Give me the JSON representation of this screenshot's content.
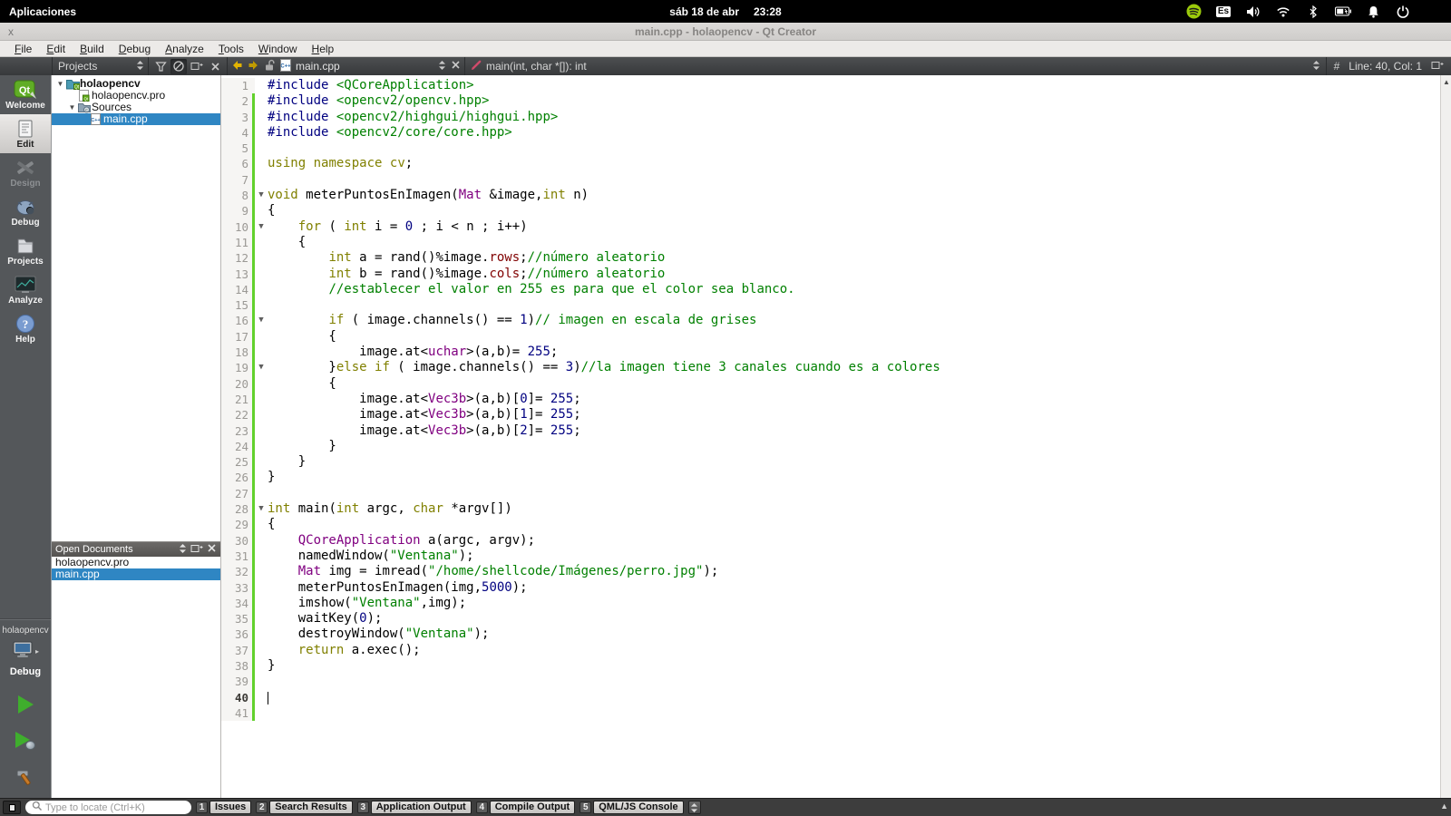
{
  "desktop": {
    "apps_menu": "Aplicaciones",
    "clock_date": "sáb 18 de abr",
    "clock_time": "23:28",
    "tray": [
      {
        "icon": "spotify-icon"
      },
      {
        "icon": "keyboard-layout-icon",
        "label": "Es"
      },
      {
        "icon": "volume-icon"
      },
      {
        "icon": "wifi-icon"
      },
      {
        "icon": "bluetooth-icon"
      },
      {
        "icon": "battery-icon"
      },
      {
        "icon": "notifications-bell-icon"
      },
      {
        "icon": "power-icon"
      }
    ]
  },
  "window": {
    "close_label": "x",
    "title": "main.cpp - holaopencv - Qt Creator",
    "menus": [
      "File",
      "Edit",
      "Build",
      "Debug",
      "Analyze",
      "Tools",
      "Window",
      "Help"
    ]
  },
  "editor_toolbar": {
    "pane_selector": "Projects",
    "open_file": "main.cpp",
    "symbol": "main(int, char *[]): int",
    "hash": "#",
    "cursor_position": "Line: 40, Col: 1"
  },
  "sidebar": {
    "modes": [
      {
        "label": "Welcome",
        "icon": "qt-welcome-icon",
        "active": false,
        "disabled": false
      },
      {
        "label": "Edit",
        "icon": "edit-document-icon",
        "active": true,
        "disabled": false
      },
      {
        "label": "Design",
        "icon": "design-tools-icon",
        "active": false,
        "disabled": true
      },
      {
        "label": "Debug",
        "icon": "debug-bug-icon",
        "active": false,
        "disabled": false
      },
      {
        "label": "Projects",
        "icon": "projects-folder-icon",
        "active": false,
        "disabled": false
      },
      {
        "label": "Analyze",
        "icon": "analyze-screen-icon",
        "active": false,
        "disabled": false
      },
      {
        "label": "Help",
        "icon": "help-question-icon",
        "active": false,
        "disabled": false
      }
    ],
    "kit": {
      "project": "holaopencv",
      "build_config": "Debug"
    }
  },
  "project_tree": {
    "rows": [
      {
        "label": "holaopencv",
        "depth": 0,
        "expanded": true,
        "bold": true,
        "icon": "qt-project-folder-icon",
        "selected": false
      },
      {
        "label": "holaopencv.pro",
        "depth": 1,
        "expanded": null,
        "bold": false,
        "icon": "pro-file-icon",
        "selected": false
      },
      {
        "label": "Sources",
        "depth": 1,
        "expanded": true,
        "bold": false,
        "icon": "sources-folder-icon",
        "selected": false
      },
      {
        "label": "main.cpp",
        "depth": 2,
        "expanded": null,
        "bold": false,
        "icon": "cpp-file-icon",
        "selected": true
      }
    ]
  },
  "open_documents": {
    "title": "Open Documents",
    "items": [
      {
        "label": "holaopencv.pro",
        "selected": false
      },
      {
        "label": "main.cpp",
        "selected": true
      }
    ]
  },
  "code": {
    "cursor_line": 40,
    "lines": [
      {
        "n": 1,
        "ch": false,
        "f": false,
        "seg": [
          [
            "pre",
            "#include"
          ],
          [
            "pln",
            " "
          ],
          [
            "grn",
            "<QCoreApplication>"
          ]
        ]
      },
      {
        "n": 2,
        "ch": true,
        "f": false,
        "seg": [
          [
            "pre",
            "#include"
          ],
          [
            "pln",
            " "
          ],
          [
            "grn",
            "<opencv2/opencv.hpp>"
          ]
        ]
      },
      {
        "n": 3,
        "ch": true,
        "f": false,
        "seg": [
          [
            "pre",
            "#include"
          ],
          [
            "pln",
            " "
          ],
          [
            "grn",
            "<opencv2/highgui/highgui.hpp>"
          ]
        ]
      },
      {
        "n": 4,
        "ch": true,
        "f": false,
        "seg": [
          [
            "pre",
            "#include"
          ],
          [
            "pln",
            " "
          ],
          [
            "grn",
            "<opencv2/core/core.hpp>"
          ]
        ]
      },
      {
        "n": 5,
        "ch": true,
        "f": false,
        "seg": []
      },
      {
        "n": 6,
        "ch": true,
        "f": false,
        "seg": [
          [
            "kw",
            "using"
          ],
          [
            "pln",
            " "
          ],
          [
            "kw",
            "namespace"
          ],
          [
            "pln",
            " "
          ],
          [
            "kw",
            "cv"
          ],
          [
            "pln",
            ";"
          ]
        ]
      },
      {
        "n": 7,
        "ch": true,
        "f": false,
        "seg": []
      },
      {
        "n": 8,
        "ch": true,
        "f": true,
        "seg": [
          [
            "kw",
            "void"
          ],
          [
            "pln",
            " meterPuntosEnImagen("
          ],
          [
            "typ",
            "Mat"
          ],
          [
            "pln",
            " &image,"
          ],
          [
            "kw",
            "int"
          ],
          [
            "pln",
            " n)"
          ]
        ]
      },
      {
        "n": 9,
        "ch": true,
        "f": false,
        "seg": [
          [
            "pln",
            "{"
          ]
        ]
      },
      {
        "n": 10,
        "ch": true,
        "f": true,
        "seg": [
          [
            "pln",
            "    "
          ],
          [
            "kw",
            "for"
          ],
          [
            "pln",
            " ( "
          ],
          [
            "kw",
            "int"
          ],
          [
            "pln",
            " i = "
          ],
          [
            "num",
            "0"
          ],
          [
            "pln",
            " ; i < n ; i++)"
          ]
        ]
      },
      {
        "n": 11,
        "ch": true,
        "f": false,
        "seg": [
          [
            "pln",
            "    {"
          ]
        ]
      },
      {
        "n": 12,
        "ch": true,
        "f": false,
        "seg": [
          [
            "pln",
            "        "
          ],
          [
            "kw",
            "int"
          ],
          [
            "pln",
            " a = rand()%image."
          ],
          [
            "fld",
            "rows"
          ],
          [
            "pln",
            ";"
          ],
          [
            "grn",
            "//número aleatorio"
          ]
        ]
      },
      {
        "n": 13,
        "ch": true,
        "f": false,
        "seg": [
          [
            "pln",
            "        "
          ],
          [
            "kw",
            "int"
          ],
          [
            "pln",
            " b = rand()%image."
          ],
          [
            "fld",
            "cols"
          ],
          [
            "pln",
            ";"
          ],
          [
            "grn",
            "//número aleatorio"
          ]
        ]
      },
      {
        "n": 14,
        "ch": true,
        "f": false,
        "seg": [
          [
            "pln",
            "        "
          ],
          [
            "grn",
            "//establecer el valor en 255 es para que el color sea blanco."
          ]
        ]
      },
      {
        "n": 15,
        "ch": true,
        "f": false,
        "seg": []
      },
      {
        "n": 16,
        "ch": true,
        "f": true,
        "seg": [
          [
            "pln",
            "        "
          ],
          [
            "kw",
            "if"
          ],
          [
            "pln",
            " ( image.channels() == "
          ],
          [
            "num",
            "1"
          ],
          [
            "pln",
            ")"
          ],
          [
            "grn",
            "// imagen en escala de grises"
          ]
        ]
      },
      {
        "n": 17,
        "ch": true,
        "f": false,
        "seg": [
          [
            "pln",
            "        {"
          ]
        ]
      },
      {
        "n": 18,
        "ch": true,
        "f": false,
        "seg": [
          [
            "pln",
            "            image.at<"
          ],
          [
            "typ",
            "uchar"
          ],
          [
            "pln",
            ">(a,b)= "
          ],
          [
            "num",
            "255"
          ],
          [
            "pln",
            ";"
          ]
        ]
      },
      {
        "n": 19,
        "ch": true,
        "f": true,
        "seg": [
          [
            "pln",
            "        }"
          ],
          [
            "kw",
            "else"
          ],
          [
            "pln",
            " "
          ],
          [
            "kw",
            "if"
          ],
          [
            "pln",
            " ( image.channels() == "
          ],
          [
            "num",
            "3"
          ],
          [
            "pln",
            ")"
          ],
          [
            "grn",
            "//la imagen tiene 3 canales cuando es a colores"
          ]
        ]
      },
      {
        "n": 20,
        "ch": true,
        "f": false,
        "seg": [
          [
            "pln",
            "        {"
          ]
        ]
      },
      {
        "n": 21,
        "ch": true,
        "f": false,
        "seg": [
          [
            "pln",
            "            image.at<"
          ],
          [
            "typ",
            "Vec3b"
          ],
          [
            "pln",
            ">(a,b)["
          ],
          [
            "num",
            "0"
          ],
          [
            "pln",
            "]= "
          ],
          [
            "num",
            "255"
          ],
          [
            "pln",
            ";"
          ]
        ]
      },
      {
        "n": 22,
        "ch": true,
        "f": false,
        "seg": [
          [
            "pln",
            "            image.at<"
          ],
          [
            "typ",
            "Vec3b"
          ],
          [
            "pln",
            ">(a,b)["
          ],
          [
            "num",
            "1"
          ],
          [
            "pln",
            "]= "
          ],
          [
            "num",
            "255"
          ],
          [
            "pln",
            ";"
          ]
        ]
      },
      {
        "n": 23,
        "ch": true,
        "f": false,
        "seg": [
          [
            "pln",
            "            image.at<"
          ],
          [
            "typ",
            "Vec3b"
          ],
          [
            "pln",
            ">(a,b)["
          ],
          [
            "num",
            "2"
          ],
          [
            "pln",
            "]= "
          ],
          [
            "num",
            "255"
          ],
          [
            "pln",
            ";"
          ]
        ]
      },
      {
        "n": 24,
        "ch": true,
        "f": false,
        "seg": [
          [
            "pln",
            "        }"
          ]
        ]
      },
      {
        "n": 25,
        "ch": true,
        "f": false,
        "seg": [
          [
            "pln",
            "    }"
          ]
        ]
      },
      {
        "n": 26,
        "ch": true,
        "f": false,
        "seg": [
          [
            "pln",
            "}"
          ]
        ]
      },
      {
        "n": 27,
        "ch": true,
        "f": false,
        "seg": []
      },
      {
        "n": 28,
        "ch": true,
        "f": true,
        "seg": [
          [
            "kw",
            "int"
          ],
          [
            "pln",
            " main("
          ],
          [
            "kw",
            "int"
          ],
          [
            "pln",
            " argc, "
          ],
          [
            "kw",
            "char"
          ],
          [
            "pln",
            " *argv[])"
          ]
        ]
      },
      {
        "n": 29,
        "ch": true,
        "f": false,
        "seg": [
          [
            "pln",
            "{"
          ]
        ]
      },
      {
        "n": 30,
        "ch": true,
        "f": false,
        "seg": [
          [
            "pln",
            "    "
          ],
          [
            "typ",
            "QCoreApplication"
          ],
          [
            "pln",
            " a(argc, argv);"
          ]
        ]
      },
      {
        "n": 31,
        "ch": true,
        "f": false,
        "seg": [
          [
            "pln",
            "    namedWindow("
          ],
          [
            "grn",
            "\"Ventana\""
          ],
          [
            "pln",
            ");"
          ]
        ]
      },
      {
        "n": 32,
        "ch": true,
        "f": false,
        "seg": [
          [
            "pln",
            "    "
          ],
          [
            "typ",
            "Mat"
          ],
          [
            "pln",
            " img = imread("
          ],
          [
            "grn",
            "\"/home/shellcode/Imágenes/perro.jpg\""
          ],
          [
            "pln",
            ");"
          ]
        ]
      },
      {
        "n": 33,
        "ch": true,
        "f": false,
        "seg": [
          [
            "pln",
            "    meterPuntosEnImagen(img,"
          ],
          [
            "num",
            "5000"
          ],
          [
            "pln",
            ");"
          ]
        ]
      },
      {
        "n": 34,
        "ch": true,
        "f": false,
        "seg": [
          [
            "pln",
            "    imshow("
          ],
          [
            "grn",
            "\"Ventana\""
          ],
          [
            "pln",
            ",img);"
          ]
        ]
      },
      {
        "n": 35,
        "ch": true,
        "f": false,
        "seg": [
          [
            "pln",
            "    waitKey("
          ],
          [
            "num",
            "0"
          ],
          [
            "pln",
            ");"
          ]
        ]
      },
      {
        "n": 36,
        "ch": true,
        "f": false,
        "seg": [
          [
            "pln",
            "    destroyWindow("
          ],
          [
            "grn",
            "\"Ventana\""
          ],
          [
            "pln",
            ");"
          ]
        ]
      },
      {
        "n": 37,
        "ch": true,
        "f": false,
        "seg": [
          [
            "pln",
            "    "
          ],
          [
            "kw",
            "return"
          ],
          [
            "pln",
            " a.exec();"
          ]
        ]
      },
      {
        "n": 38,
        "ch": true,
        "f": false,
        "seg": [
          [
            "pln",
            "}"
          ]
        ]
      },
      {
        "n": 39,
        "ch": true,
        "f": false,
        "seg": []
      },
      {
        "n": 40,
        "ch": true,
        "f": false,
        "seg": [],
        "cursor": true
      },
      {
        "n": 41,
        "ch": true,
        "f": false,
        "seg": []
      }
    ]
  },
  "bottom_bar": {
    "locator_placeholder": "Type to locate (Ctrl+K)",
    "panes": [
      {
        "num": "1",
        "label": "Issues"
      },
      {
        "num": "2",
        "label": "Search Results"
      },
      {
        "num": "3",
        "label": "Application Output"
      },
      {
        "num": "4",
        "label": "Compile Output"
      },
      {
        "num": "5",
        "label": "QML/JS Console"
      }
    ]
  },
  "colors": {
    "selection_blue": "#2f86c3",
    "change_bar_green": "#62d12c",
    "syntax_keyword": "#808000",
    "syntax_preprocessor": "#000080",
    "syntax_type": "#800080",
    "syntax_number": "#000080",
    "syntax_string_comment": "#008000",
    "syntax_field": "#800000",
    "run_green": "#3fae2d",
    "spotify_green": "#9bca0b"
  }
}
